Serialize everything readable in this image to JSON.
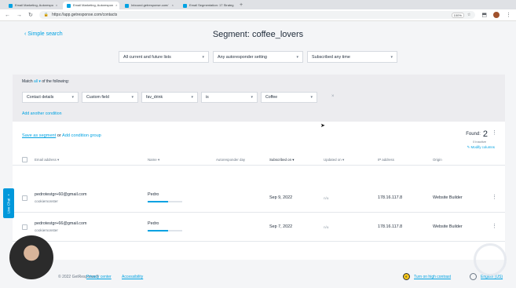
{
  "browser": {
    "tabs": [
      {
        "label": "Email Marketing, Autorespo",
        "active": false
      },
      {
        "label": "Email Marketing, Autorespon",
        "active": true
      },
      {
        "label": "Inbound.getresponse.com/",
        "active": false
      },
      {
        "label": "Email Segmentation: 17 Strateg",
        "active": false
      }
    ],
    "new_tab": "+",
    "url": "https://app.getresponse.com/contacts",
    "zoom": "100%"
  },
  "header": {
    "back_link": "Simple search",
    "title": "Segment: coffee_lovers"
  },
  "filters": [
    {
      "label": "All current and future lists"
    },
    {
      "label": "Any autoresponder setting"
    },
    {
      "label": "Subscribed any time"
    }
  ],
  "conditions": {
    "match_prefix": "Match",
    "match_value": "all",
    "match_suffix": "of the following:",
    "row": [
      {
        "label": "Contact details"
      },
      {
        "label": "Custom field"
      },
      {
        "label": "fav_drink"
      },
      {
        "label": "is"
      },
      {
        "label": "Coffee"
      }
    ],
    "remove": "×",
    "add_another": "Add another condition"
  },
  "results": {
    "save_as_segment": "Save as segment",
    "or": "or",
    "add_condition_group": "Add condition group",
    "found_label": "Found:",
    "found_count": "2",
    "inactive": "0 inactive",
    "modify_columns": "Modify columns",
    "columns": [
      "Email address",
      "Name",
      "Autoresponder day",
      "Subscribed on",
      "Updated on",
      "IP address",
      "Origin"
    ],
    "rows": [
      {
        "email": "pedrotestgr+60@gmail.com",
        "list": "cookiemonster",
        "name": "Pedro",
        "engagement": 0.6,
        "subscribed": "Sep 9, 2022",
        "updated": "n/a",
        "ip": "178.16.117.8",
        "origin": "Website Builder"
      },
      {
        "email": "pedrotestgr+66@gmail.com",
        "list": "cookiemonster",
        "name": "Pedro",
        "engagement": 0.6,
        "subscribed": "Sep 7, 2022",
        "updated": "n/a",
        "ip": "178.16.117.8",
        "origin": "Website Builder"
      }
    ]
  },
  "footer": {
    "copyright": "© 2022 GetResponse®",
    "privacy": "Privacy center",
    "accessibility": "Accessibility",
    "contrast": "Turn on high contrast",
    "language": "English (US)"
  },
  "live_chat": "Live Chat",
  "colors": {
    "accent": "#00a2e2",
    "text": "#1f2b3a",
    "muted": "#6b7785"
  }
}
